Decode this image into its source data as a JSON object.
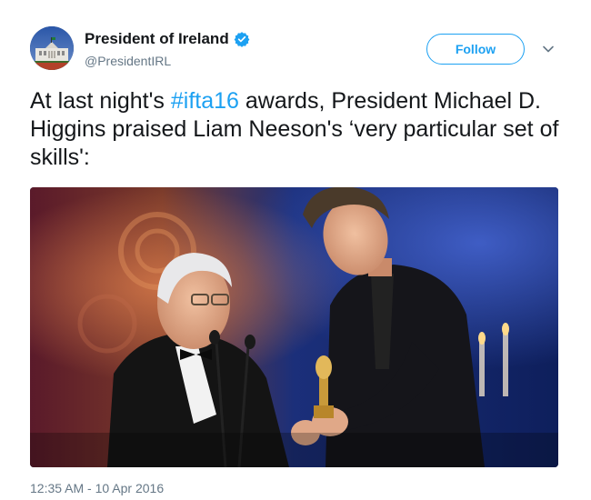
{
  "tweet": {
    "author": {
      "display_name": "President of Ireland",
      "handle": "@PresidentIRL",
      "verified": true
    },
    "follow_label": "Follow",
    "text": {
      "prefix": "At last night's ",
      "hashtag": "#ifta16",
      "suffix": " awards, President Michael D. Higgins praised Liam Neeson's ‘very particular set of skills':"
    },
    "timestamp": "12:35 AM - 10 Apr 2016",
    "colors": {
      "accent": "#1da1f2",
      "secondary_text": "#657786",
      "primary_text": "#14171a"
    }
  }
}
